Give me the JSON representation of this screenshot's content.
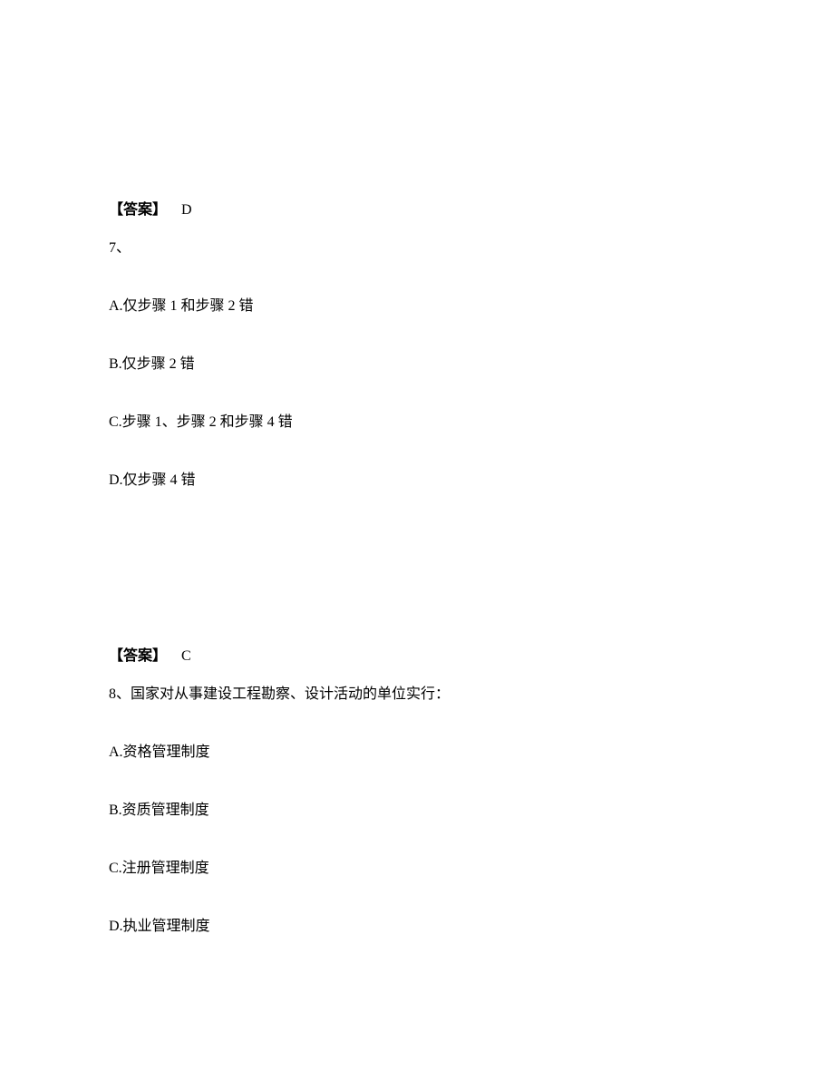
{
  "answer6": {
    "label": "【答案】",
    "value": "D"
  },
  "question7": {
    "number": "7、",
    "options": {
      "a": "A.仅步骤 1 和步骤 2 错",
      "b": "B.仅步骤 2 错",
      "c": "C.步骤 1、步骤 2 和步骤 4 错",
      "d": "D.仅步骤 4 错"
    }
  },
  "answer7": {
    "label": "【答案】",
    "value": "C"
  },
  "question8": {
    "text": "8、国家对从事建设工程勘察、设计活动的单位实行：",
    "options": {
      "a": "A.资格管理制度",
      "b": "B.资质管理制度",
      "c": "C.注册管理制度",
      "d": "D.执业管理制度"
    }
  }
}
